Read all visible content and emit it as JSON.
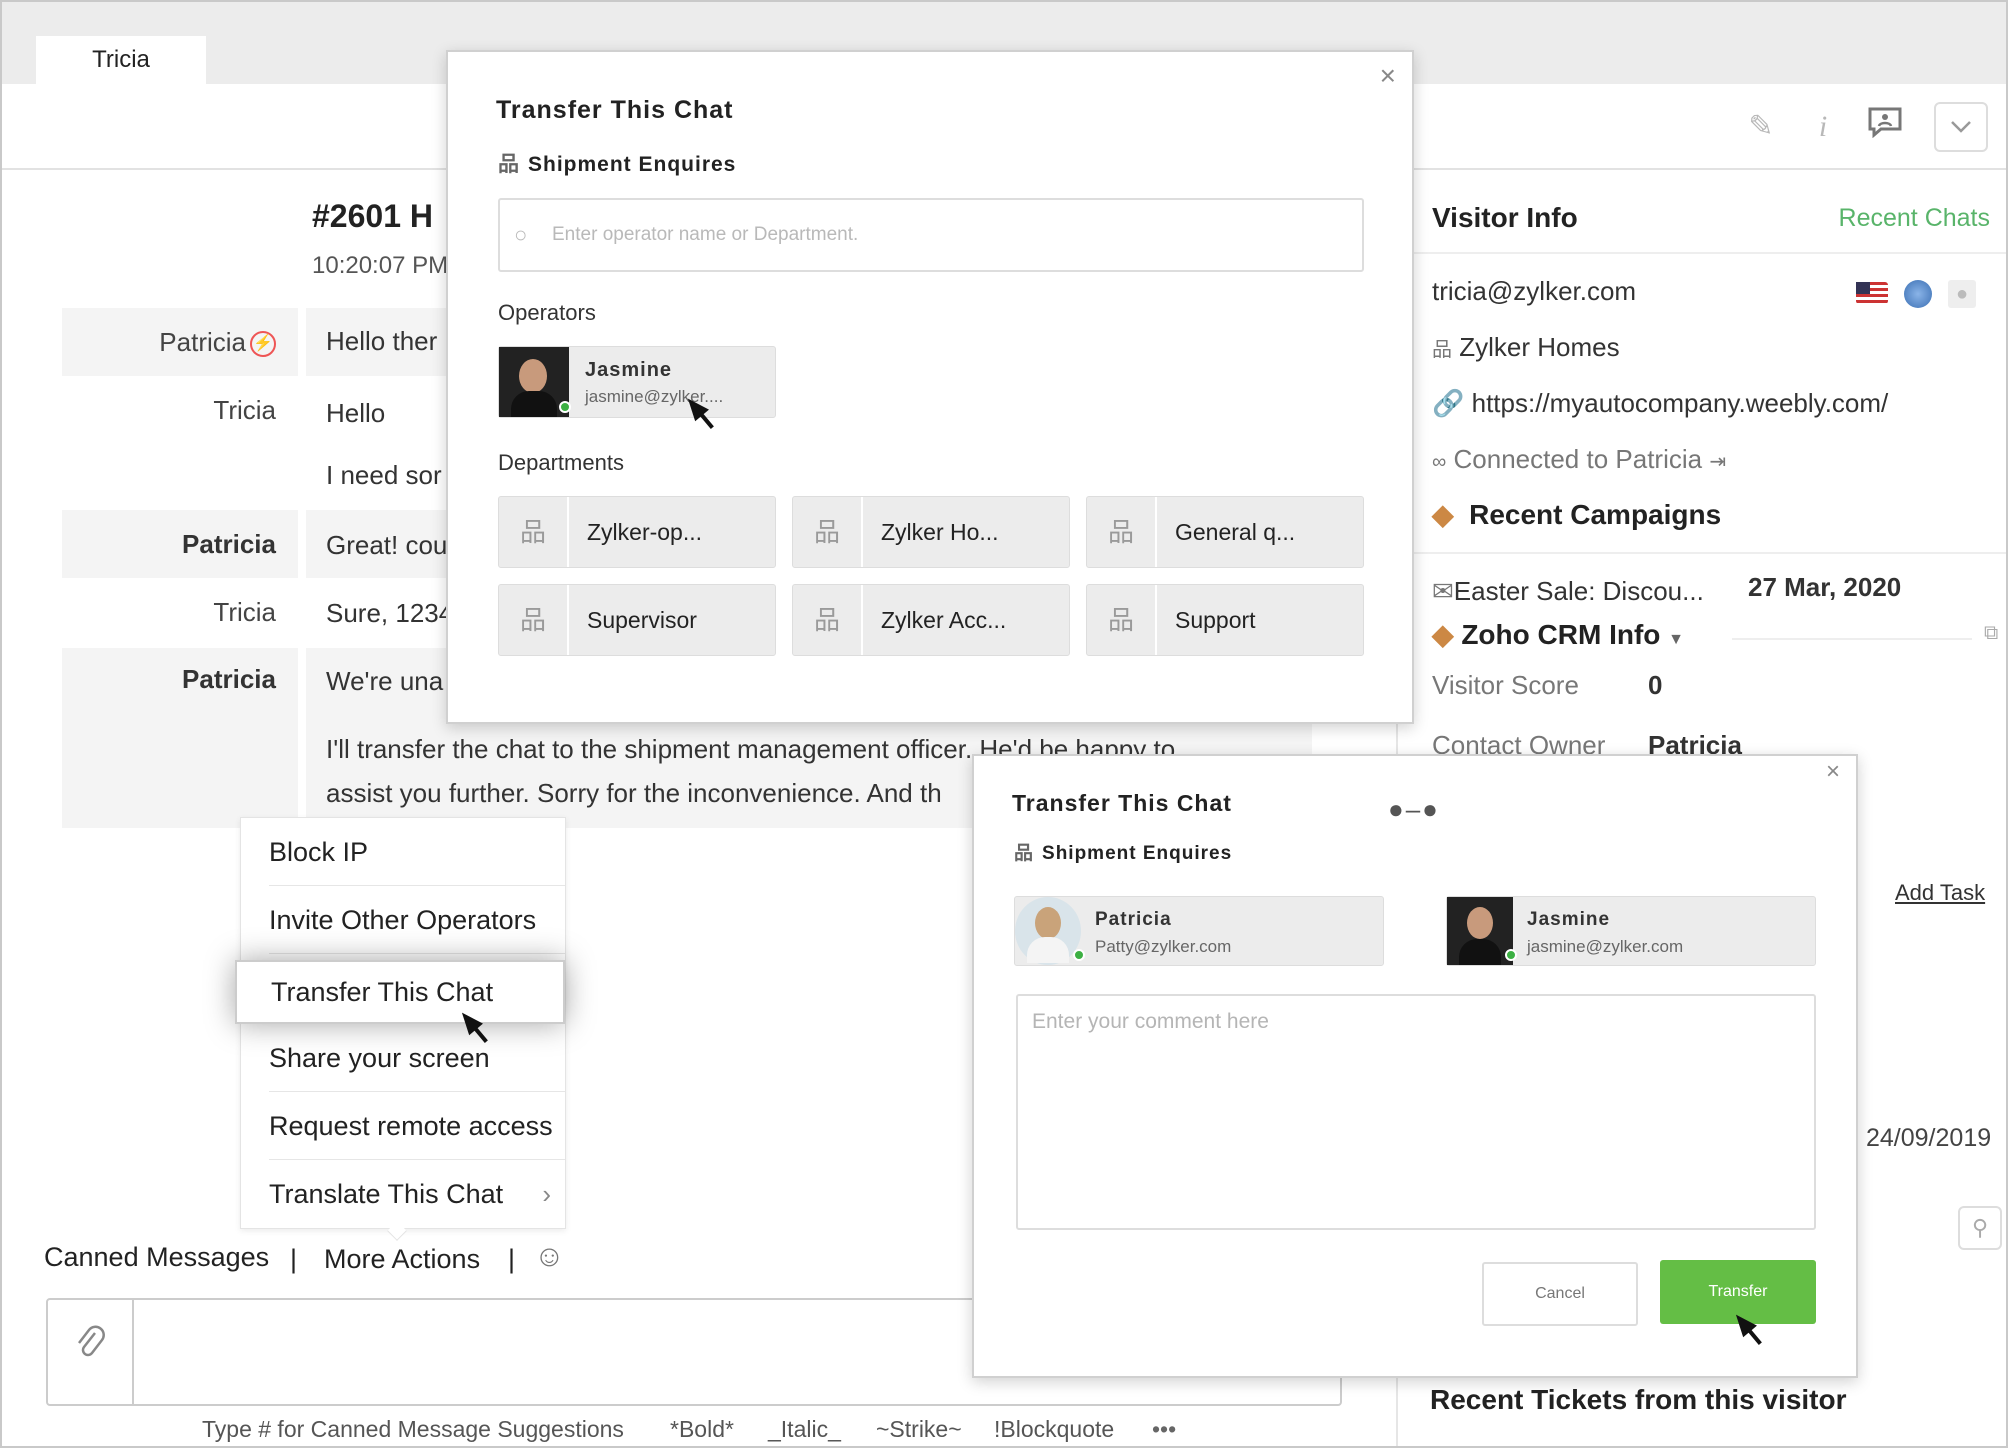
{
  "tab": {
    "label": "Tricia"
  },
  "chat": {
    "title": "#2601 H",
    "time": "10:20:07 PM",
    "messages": [
      {
        "sender": "Patricia",
        "text": "Hello ther"
      },
      {
        "sender": "Tricia",
        "text": "Hello"
      },
      {
        "sender": "",
        "text": "I need sor"
      },
      {
        "sender": "Patricia",
        "text": "Great! cou"
      },
      {
        "sender": "Tricia",
        "text": "Sure, 1234"
      },
      {
        "sender": "Patricia",
        "text": "We're una"
      },
      {
        "sender": "",
        "text": "I'll transfer the chat to the shipment management officer. He'd be happy to"
      },
      {
        "sender": "",
        "text": "assist you further. Sorry for the inconvenience. And th"
      }
    ]
  },
  "menu": {
    "items": [
      "Block IP",
      "Invite Other Operators",
      "Transfer This Chat",
      "Share your screen",
      "Request remote access",
      "Translate This Chat"
    ]
  },
  "actions": {
    "canned": "Canned Messages",
    "sep": "|",
    "more": "More Actions"
  },
  "hints": [
    "Type # for Canned Message Suggestions",
    "*Bold*",
    "_Italic_",
    "~Strike~",
    "!Blockquote",
    "•••"
  ],
  "visitor": {
    "heading": "Visitor Info",
    "recent_chats": "Recent Chats",
    "email": "tricia@zylker.com",
    "company": "Zylker Homes",
    "url": "https://myautocompany.weebly.com/",
    "connected": "Connected to Patricia",
    "campaigns_heading": "Recent Campaigns",
    "campaign": "Easter Sale: Discou...",
    "campaign_date": "27 Mar, 2020",
    "crm_heading": "Zoho CRM Info",
    "score_label": "Visitor Score",
    "score_value": "0",
    "owner_label": "Contact Owner",
    "owner_value": "Patricia",
    "add_task": "Add Task",
    "date": "24/09/2019",
    "recent_tickets": "Recent Tickets from this visitor"
  },
  "transfer_modal": {
    "title": "Transfer This Chat",
    "department": "Shipment Enquires",
    "search_placeholder": "Enter operator name or Department.",
    "operators_label": "Operators",
    "operator": {
      "name": "Jasmine",
      "email": "jasmine@zylker...."
    },
    "departments_label": "Departments",
    "departments": [
      "Zylker-op...",
      "Zylker Ho...",
      "General q...",
      "Supervisor",
      "Zylker Acc...",
      "Support"
    ]
  },
  "confirm_modal": {
    "title": "Transfer This Chat",
    "department": "Shipment Enquires",
    "from": {
      "name": "Patricia",
      "email": "Patty@zylker.com"
    },
    "to": {
      "name": "Jasmine",
      "email": "jasmine@zylker.com"
    },
    "comment_placeholder": "Enter your comment here",
    "cancel": "Cancel",
    "transfer": "Transfer"
  },
  "colors": {
    "accent_green": "#64be45",
    "recent_chats_green": "#59b46a",
    "online": "#3cb043"
  }
}
